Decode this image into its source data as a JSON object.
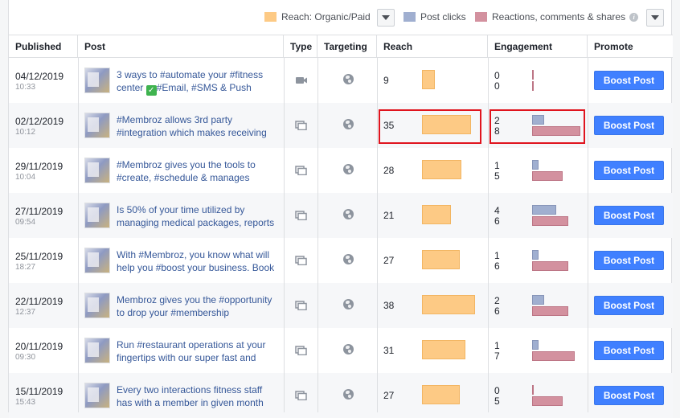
{
  "legend": {
    "reach": {
      "label": "Reach: Organic/Paid",
      "color": "#fdca85"
    },
    "clicks": {
      "label": "Post clicks",
      "color": "#a0afd0"
    },
    "reactions": {
      "label": "Reactions, comments & shares",
      "color": "#d3919f"
    },
    "info_glyph": "i"
  },
  "columns": {
    "published": "Published",
    "post": "Post",
    "type": "Type",
    "targeting": "Targeting",
    "reach": "Reach",
    "engagement": "Engagement",
    "promote": "Promote"
  },
  "reach_max": 38,
  "engagement_max": 8,
  "rows": [
    {
      "date": "04/12/2019",
      "time": "10:33",
      "line1": "3 ways to #automate your #fitness",
      "line2_pre": "center ",
      "check": "✓",
      "line2": "#Email, #SMS & Push",
      "type": "video",
      "reach": 9,
      "clicks": 0,
      "reactions": 0,
      "button": "Boost Post"
    },
    {
      "date": "02/12/2019",
      "time": "10:12",
      "line1": "#Membroz allows 3rd party",
      "line2_pre": "",
      "check": "",
      "line2": "#integration which makes receiving",
      "type": "carousel",
      "reach": 35,
      "clicks": 2,
      "reactions": 8,
      "button": "Boost Post",
      "highlighted": true
    },
    {
      "date": "29/11/2019",
      "time": "10:04",
      "line1": "#Membroz gives you the tools to",
      "line2_pre": "",
      "check": "",
      "line2": "#create, #schedule & manages",
      "type": "carousel",
      "reach": 28,
      "clicks": 1,
      "reactions": 5,
      "button": "Boost Post"
    },
    {
      "date": "27/11/2019",
      "time": "09:54",
      "line1": "Is 50% of your time utilized by",
      "line2_pre": "",
      "check": "",
      "line2": "managing medical packages, reports",
      "type": "carousel",
      "reach": 21,
      "clicks": 4,
      "reactions": 6,
      "button": "Boost Post"
    },
    {
      "date": "25/11/2019",
      "time": "18:27",
      "line1": "With #Membroz, you know what will",
      "line2_pre": "",
      "check": "",
      "line2": "help you #boost your business. Book",
      "type": "carousel",
      "reach": 27,
      "clicks": 1,
      "reactions": 6,
      "button": "Boost Post"
    },
    {
      "date": "22/11/2019",
      "time": "12:37",
      "line1": "Membroz gives you the #opportunity",
      "line2_pre": "",
      "check": "",
      "line2": "to drop your #membership",
      "type": "carousel",
      "reach": 38,
      "clicks": 2,
      "reactions": 6,
      "button": "Boost Post"
    },
    {
      "date": "20/11/2019",
      "time": "09:30",
      "line1": "Run #restaurant operations at your",
      "line2_pre": "",
      "check": "",
      "line2": "fingertips with our super fast and",
      "type": "carousel",
      "reach": 31,
      "clicks": 1,
      "reactions": 7,
      "button": "Boost Post"
    },
    {
      "date": "15/11/2019",
      "time": "15:43",
      "line1": "Every two interactions fitness staff",
      "line2_pre": "",
      "check": "",
      "line2": "has with a member in given month",
      "type": "carousel",
      "reach": 27,
      "clicks": 0,
      "reactions": 5,
      "button": "Boost Post"
    }
  ]
}
